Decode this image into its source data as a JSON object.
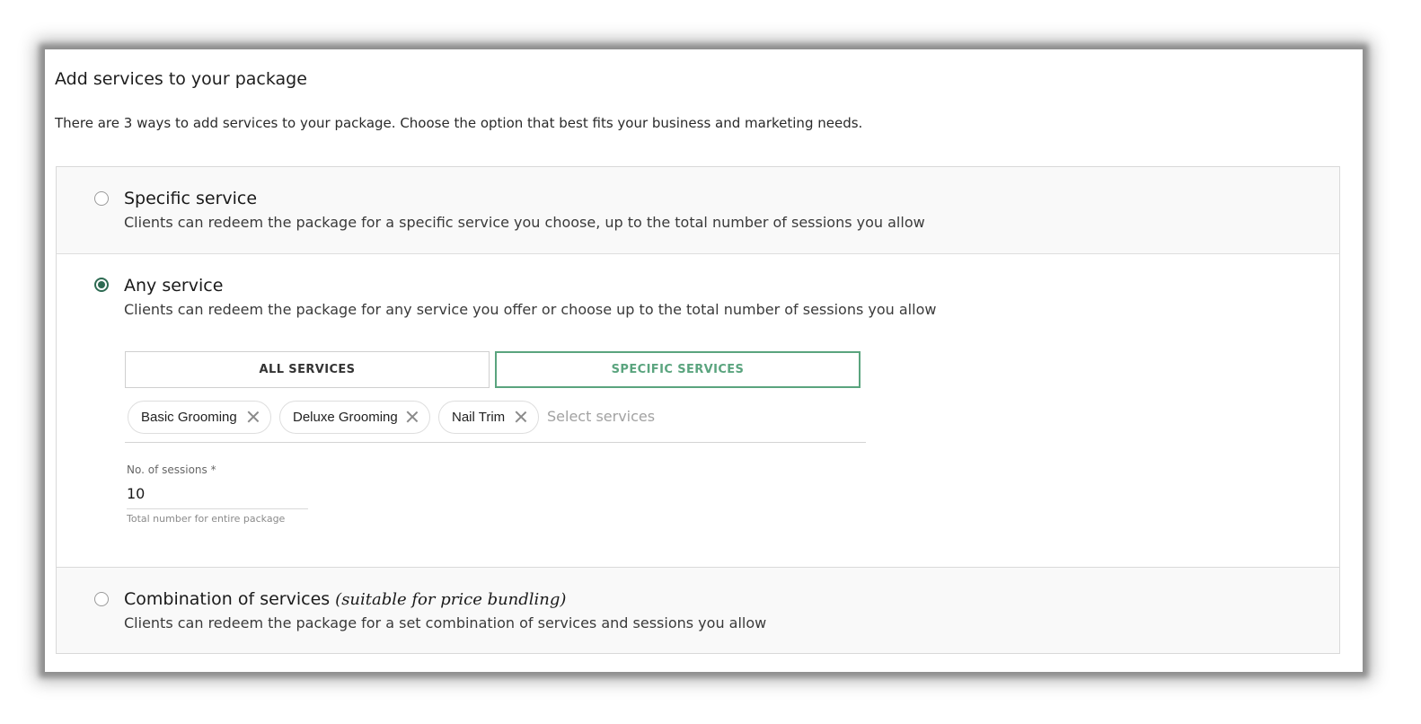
{
  "page": {
    "title": "Add services to your package",
    "subtitle": "There are 3 ways to add services to your package. Choose the option that best fits your business and marketing needs."
  },
  "options": [
    {
      "title": "Specific service",
      "description": "Clients can redeem the package for a specific service you choose, up to the total number of sessions you allow",
      "selected": false
    },
    {
      "title": "Any service",
      "description": "Clients can redeem the package for any service you offer or choose up to the total number of sessions you allow",
      "selected": true,
      "scope_toggle": {
        "all_label": "ALL SERVICES",
        "specific_label": "SPECIFIC SERVICES",
        "active": "SPECIFIC SERVICES"
      },
      "selected_services": [
        "Basic Grooming",
        "Deluxe Grooming",
        "Nail Trim"
      ],
      "services_placeholder": "Select services",
      "sessions": {
        "label": "No. of sessions *",
        "value": "10",
        "help": "Total number for entire package"
      }
    },
    {
      "title": "Combination of services",
      "title_aside": "(suitable for price bundling)",
      "description": "Clients can redeem the package for a set combination of services and sessions you allow",
      "selected": false
    }
  ],
  "colors": {
    "accent": "#2e6b53",
    "toggle_active": "#5aa47e",
    "card_muted_bg": "#f9f9f9"
  },
  "icons": [
    "radio-unchecked-icon",
    "radio-checked-icon",
    "remove-chip-icon"
  ]
}
